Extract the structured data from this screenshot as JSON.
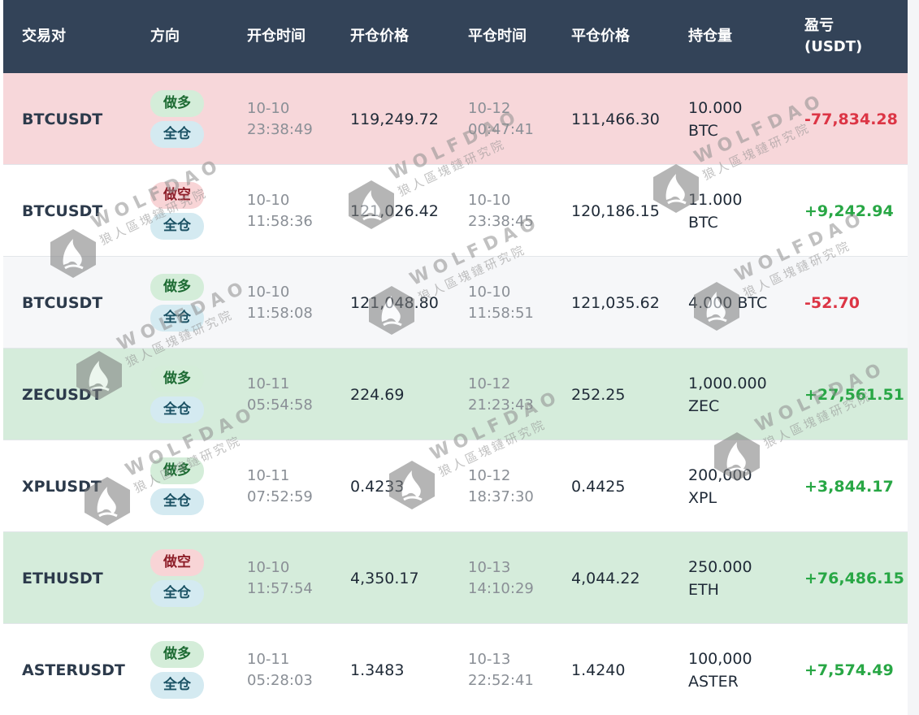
{
  "table": {
    "headers": {
      "pair": "交易对",
      "direction": "方向",
      "open_time": "开仓时间",
      "open_price": "开仓价格",
      "close_time": "平仓时间",
      "close_price": "平仓价格",
      "quantity": "持仓量",
      "pnl_line1": "盈亏",
      "pnl_line2": "(USDT)"
    },
    "rows": [
      {
        "pair": "BTCUSDT",
        "side": "做多",
        "side_type": "long",
        "margin": "全仓",
        "open_date": "10-10",
        "open_time": "23:38:49",
        "open_price": "119,249.72",
        "close_date": "10-12",
        "close_time": "00:47:41",
        "close_price": "111,466.30",
        "qty_line1": "10.000",
        "qty_line2": "BTC",
        "pnl": "-77,834.28",
        "bg": "#f7d7da",
        "pnl_color": "#dc3545"
      },
      {
        "pair": "BTCUSDT",
        "side": "做空",
        "side_type": "short",
        "margin": "全仓",
        "open_date": "10-10",
        "open_time": "11:58:36",
        "open_price": "121,026.42",
        "close_date": "10-10",
        "close_time": "23:38:45",
        "close_price": "120,186.15",
        "qty_line1": "11.000",
        "qty_line2": "BTC",
        "pnl": "+9,242.94",
        "bg": "#ffffff",
        "pnl_color": "#28a745"
      },
      {
        "pair": "BTCUSDT",
        "side": "做多",
        "side_type": "long",
        "margin": "全仓",
        "open_date": "10-10",
        "open_time": "11:58:08",
        "open_price": "121,048.80",
        "close_date": "10-10",
        "close_time": "11:58:51",
        "close_price": "121,035.62",
        "qty_line1": "4.000 BTC",
        "qty_line2": "",
        "pnl": "-52.70",
        "bg": "#f6f7f9",
        "pnl_color": "#dc3545"
      },
      {
        "pair": "ZECUSDT",
        "side": "做多",
        "side_type": "long",
        "margin": "全仓",
        "open_date": "10-11",
        "open_time": "05:54:58",
        "open_price": "224.69",
        "close_date": "10-12",
        "close_time": "21:23:43",
        "close_price": "252.25",
        "qty_line1": "1,000.000",
        "qty_line2": "ZEC",
        "pnl": "+27,561.51",
        "bg": "#d5ecdb",
        "pnl_color": "#28a745"
      },
      {
        "pair": "XPLUSDT",
        "side": "做多",
        "side_type": "long",
        "margin": "全仓",
        "open_date": "10-11",
        "open_time": "07:52:59",
        "open_price": "0.4233",
        "close_date": "10-12",
        "close_time": "18:37:30",
        "close_price": "0.4425",
        "qty_line1": "200,000",
        "qty_line2": "XPL",
        "pnl": "+3,844.17",
        "bg": "#ffffff",
        "pnl_color": "#28a745"
      },
      {
        "pair": "ETHUSDT",
        "side": "做空",
        "side_type": "short",
        "margin": "全仓",
        "open_date": "10-10",
        "open_time": "11:57:54",
        "open_price": "4,350.17",
        "close_date": "10-13",
        "close_time": "14:10:29",
        "close_price": "4,044.22",
        "qty_line1": "250.000",
        "qty_line2": "ETH",
        "pnl": "+76,486.15",
        "bg": "#d5ecdb",
        "pnl_color": "#28a745"
      },
      {
        "pair": "ASTERUSDT",
        "side": "做多",
        "side_type": "long",
        "margin": "全仓",
        "open_date": "10-11",
        "open_time": "05:28:03",
        "open_price": "1.3483",
        "close_date": "10-13",
        "close_time": "22:52:41",
        "close_price": "1.4240",
        "qty_line1": "100,000",
        "qty_line2": "ASTER",
        "pnl": "+7,574.49",
        "bg": "#ffffff",
        "pnl_color": "#28a745"
      }
    ]
  },
  "watermark": {
    "brand": "WOLFDAO",
    "subtitle": "狼人區塊鏈研究院",
    "icon": "wolf-logo-icon"
  },
  "colors": {
    "header_bg": "#334358",
    "profit": "#28a745",
    "loss": "#dc3545"
  }
}
